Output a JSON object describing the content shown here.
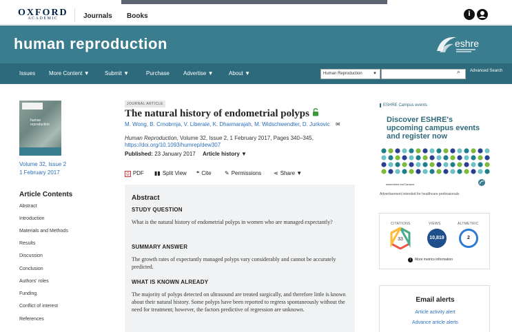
{
  "top": {
    "logo": "OXFORD",
    "logo_sub": "ACADEMIC",
    "nav": [
      "Journals",
      "Books"
    ],
    "info_icon": "i"
  },
  "banner": {
    "title": "human reproduction",
    "logo_text": "eshre"
  },
  "navbar": {
    "items": [
      "Issues",
      "More Content ▼",
      "Submit ▼",
      "Purchase",
      "Advertise ▼",
      "About ▼"
    ],
    "search_scope": "Human Reproduction",
    "advanced_search": "Advanced Search"
  },
  "sidebar": {
    "cover_title": "human reproduction",
    "volume": "Volume 32, Issue 2",
    "date": "1 February 2017",
    "contents_heading": "Article Contents",
    "contents": [
      "Abstract",
      "Introduction",
      "Materials and Methods",
      "Results",
      "Discussion",
      "Conclusion",
      "Authors' roles",
      "Funding",
      "Conflict of interest",
      "References"
    ]
  },
  "article": {
    "badge": "JOURNAL ARTICLE",
    "title": "The natural history of endometrial polyps",
    "authors": "M. Wong, B. Crnobrnja, V. Liberale, K. Dharmarajah, M. Widschwendter, D. Jurkovic",
    "journal": "Human Reproduction",
    "citation_rest": ", Volume 32, Issue 2, 1 February 2017, Pages 340–345,",
    "doi": "https://doi.org/10.1093/humrep/dew307",
    "published_label": "Published:",
    "published_date": "23 January 2017",
    "history": "Article history ▼"
  },
  "tools": [
    {
      "icon": "pdf-icon",
      "label": "PDF"
    },
    {
      "icon": "split-view-icon",
      "label": "Split View"
    },
    {
      "icon": "cite-icon",
      "label": "Cite"
    },
    {
      "icon": "permissions-icon",
      "label": "Permissions"
    },
    {
      "icon": "share-icon",
      "label": "Share ▼"
    }
  ],
  "abstract": {
    "heading": "Abstract",
    "q_h": "STUDY QUESTION",
    "q_p": "What is the natural history of endometrial polyps in women who are managed expectantly?",
    "a_h": "SUMMARY ANSWER",
    "a_p": "The growth rates of expectantly managed polyps vary considerably and cannot be accurately predicted.",
    "k_h": "WHAT IS KNOWN ALREADY",
    "k_p": "The majority of polyps detected on ultrasound are treated surgically, and therefore little is known about their natural history. Some polyps have been reported to regress spontaneously without the need for treatment; however, the factors predictive of regression are unknown."
  },
  "ad": {
    "label": "ESHRE Campus events",
    "title": "Discover ESHRE's upcoming campus events and register now",
    "url": "www.eshre.eu/Campus",
    "note": "Advertisement intended for healthcare professionals"
  },
  "metrics": {
    "citations_label": "CITATIONS",
    "citations": "33",
    "views_label": "VIEWS",
    "views": "10,819",
    "altmetric_label": "ALTMETRIC",
    "altmetric": "2",
    "more": "More metrics information"
  },
  "alerts": {
    "heading": "Email alerts",
    "links": [
      "Article activity alert",
      "Advance article alerts"
    ]
  }
}
